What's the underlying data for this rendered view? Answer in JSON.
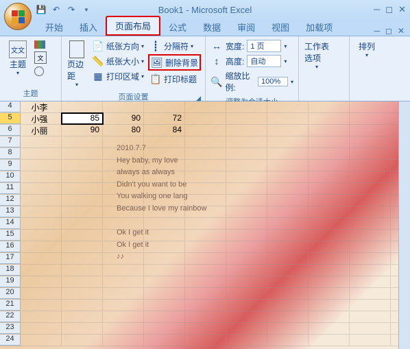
{
  "title": "Book1 - Microsoft Excel",
  "tabs": [
    "开始",
    "插入",
    "页面布局",
    "公式",
    "数据",
    "审阅",
    "视图",
    "加载项"
  ],
  "active_tab": 2,
  "ribbon": {
    "theme": {
      "label": "主题",
      "btn": "主题"
    },
    "page_setup": {
      "label": "页面设置",
      "margins": "页边距",
      "orientation": "纸张方向",
      "size": "纸张大小",
      "print_area": "打印区域",
      "breaks": "分隔符",
      "delete_bg": "删除背景",
      "print_titles": "打印标题"
    },
    "scale": {
      "label": "调整为合适大小",
      "width_lbl": "宽度:",
      "width_val": "1 页",
      "height_lbl": "高度:",
      "height_val": "自动",
      "zoom_lbl": "缩放比例:",
      "zoom_val": "100%"
    },
    "sheet_opts": {
      "label": "工作表选项"
    },
    "arrange": {
      "label": "排列"
    }
  },
  "rows": [
    {
      "n": 4,
      "name": "小李",
      "c": "",
      "d": "",
      "e": ""
    },
    {
      "n": 5,
      "name": "小强",
      "c": "85",
      "d": "90",
      "e": "72",
      "sel": true
    },
    {
      "n": 6,
      "name": "小丽",
      "c": "90",
      "d": "80",
      "e": "84"
    }
  ],
  "empty_rows": [
    7,
    8,
    9,
    10,
    11,
    12,
    13,
    14,
    15,
    16,
    17,
    18,
    19,
    20,
    21,
    22,
    23,
    24
  ],
  "poem": [
    "2010.7.7",
    "Hey baby, my love",
    "always as always",
    "Didn't you want to be",
    "You walking one lang",
    "Because I love my rainbow",
    "",
    "Ok I get it",
    "Ok I get it",
    "♪♪"
  ]
}
